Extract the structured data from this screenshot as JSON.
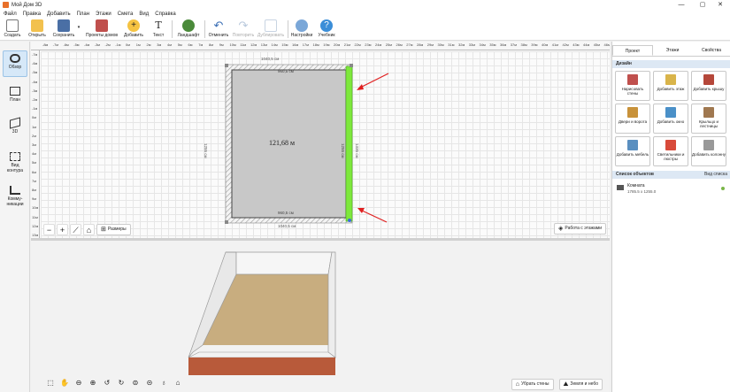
{
  "window": {
    "title": "Мой Дом 3D",
    "controls": [
      "—",
      "▢",
      "✕"
    ]
  },
  "menu": [
    "Файл",
    "Правка",
    "Добавить",
    "План",
    "Этажи",
    "Смета",
    "Вид",
    "Справка"
  ],
  "toolbar": {
    "create": "Создать",
    "open": "Открыть",
    "save": "Сохранить",
    "projects": "Проекты домов",
    "add": "Добавить",
    "text": "Текст",
    "landscape": "Ландшафт",
    "undo": "Отменить",
    "redo": "Повторить",
    "duplicate": "Дублировать",
    "settings": "Настройки",
    "tutorial": "Учебник"
  },
  "leftbar": {
    "overview": "Обзор",
    "plan": "План",
    "view3d": "3D",
    "contour": "Вид контура",
    "communications": "Комму-никации"
  },
  "plan": {
    "ruler_top": [
      "-8м",
      "-7м",
      "-6м",
      "-5м",
      "-4м",
      "-3м",
      "-2м",
      "-1м",
      "0м",
      "1м",
      "2м",
      "3м",
      "4м",
      "5м",
      "6м",
      "7м",
      "8м",
      "9м",
      "10м",
      "11м",
      "12м",
      "13м",
      "14м",
      "15м",
      "16м",
      "17м",
      "18м",
      "19м",
      "20м",
      "21м",
      "22м",
      "23м",
      "24м",
      "25м",
      "26м",
      "27м",
      "28м",
      "29м",
      "30м",
      "31м",
      "32м",
      "33м",
      "34м",
      "35м",
      "36м",
      "37м",
      "38м",
      "39м",
      "40м",
      "41м",
      "42м",
      "43м",
      "44м",
      "45м",
      "46м"
    ],
    "ruler_left": [
      "-7м",
      "-6м",
      "-5м",
      "-4м",
      "-3м",
      "-2м",
      "-1м",
      "0м",
      "1м",
      "2м",
      "3м",
      "4м",
      "5м",
      "6м",
      "7м",
      "8м",
      "9м",
      "10м",
      "11м",
      "12м",
      "13м"
    ],
    "room_area": "121,68 м",
    "dim_top_outer": "1040,5 см",
    "dim_top_inner": "960,5 см",
    "dim_bottom_inner": "960,5 см",
    "dim_bottom_outer": "1040,5 см",
    "dim_left": "1255 см",
    "dim_right_inner": "1255 см",
    "dim_right_outer": "1335 см",
    "sizes_btn": "Размеры",
    "floors_btn": "Работа с этажами",
    "arrow_color": "#e02020",
    "wall_highlight_color": "#7ee83c"
  },
  "view3d": {
    "remove_walls": "Убрать стены",
    "ground_sky": "Земля и небо"
  },
  "rpanel": {
    "tabs": [
      "Проект",
      "Этажи",
      "Свойства"
    ],
    "design_title": "Дизайн",
    "tiles": [
      {
        "label": "Нарисовать стены",
        "color": "#c0504d"
      },
      {
        "label": "Добавить этаж",
        "color": "#d9b44a"
      },
      {
        "label": "Добавить крышу",
        "color": "#b5473a"
      },
      {
        "label": "Двери и ворота",
        "color": "#c8923a"
      },
      {
        "label": "Добавить окно",
        "color": "#4a90c8"
      },
      {
        "label": "Крыльцо и лестницы",
        "color": "#a07850"
      },
      {
        "label": "Добавить мебель",
        "color": "#5a8fc0"
      },
      {
        "label": "Светильники и люстры",
        "color": "#d84a3a"
      },
      {
        "label": "Добавить колонну",
        "color": "#999999"
      }
    ],
    "objects_title": "Список объектов",
    "objects_mode": "Вид списка",
    "object_name": "Комната",
    "object_size": "1785.5 x 1255.0"
  }
}
